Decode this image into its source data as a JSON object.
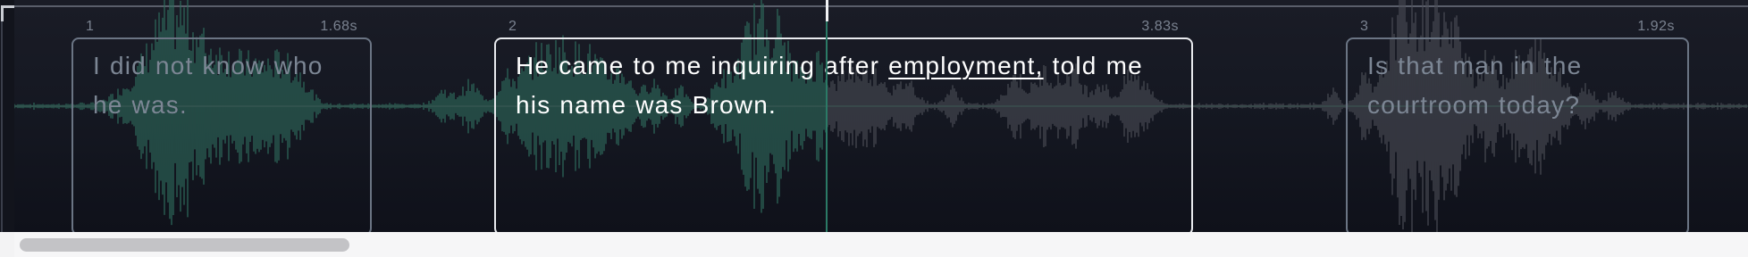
{
  "editor": {
    "segments": [
      {
        "index": "1",
        "duration": "1.68s",
        "words": [
          "I",
          "did",
          "not",
          "know",
          "who",
          "he",
          "was."
        ],
        "active": false,
        "played": true
      },
      {
        "index": "2",
        "duration": "3.83s",
        "words": [
          "He",
          "came",
          "to",
          "me",
          "inquiring",
          "after",
          "employment,",
          "told",
          "me",
          "his",
          "name",
          "was",
          "Brown."
        ],
        "active": true,
        "highlight_word": "employment,",
        "played": "partial"
      },
      {
        "index": "3",
        "duration": "1.92s",
        "words": [
          "Is",
          "that",
          "man",
          "in",
          "the",
          "courtroom",
          "today?"
        ],
        "active": false,
        "played": false
      }
    ]
  },
  "colors": {
    "played_wave": "#2e6b5c",
    "unplayed_wave": "#4a4c55",
    "playhead": "#2b7a66",
    "active_border": "#e9ebef",
    "inactive_border": "#6b7584",
    "background": "#12141c"
  },
  "scrollbar": {
    "position_fraction": 0.0,
    "visible_fraction": 0.19
  }
}
